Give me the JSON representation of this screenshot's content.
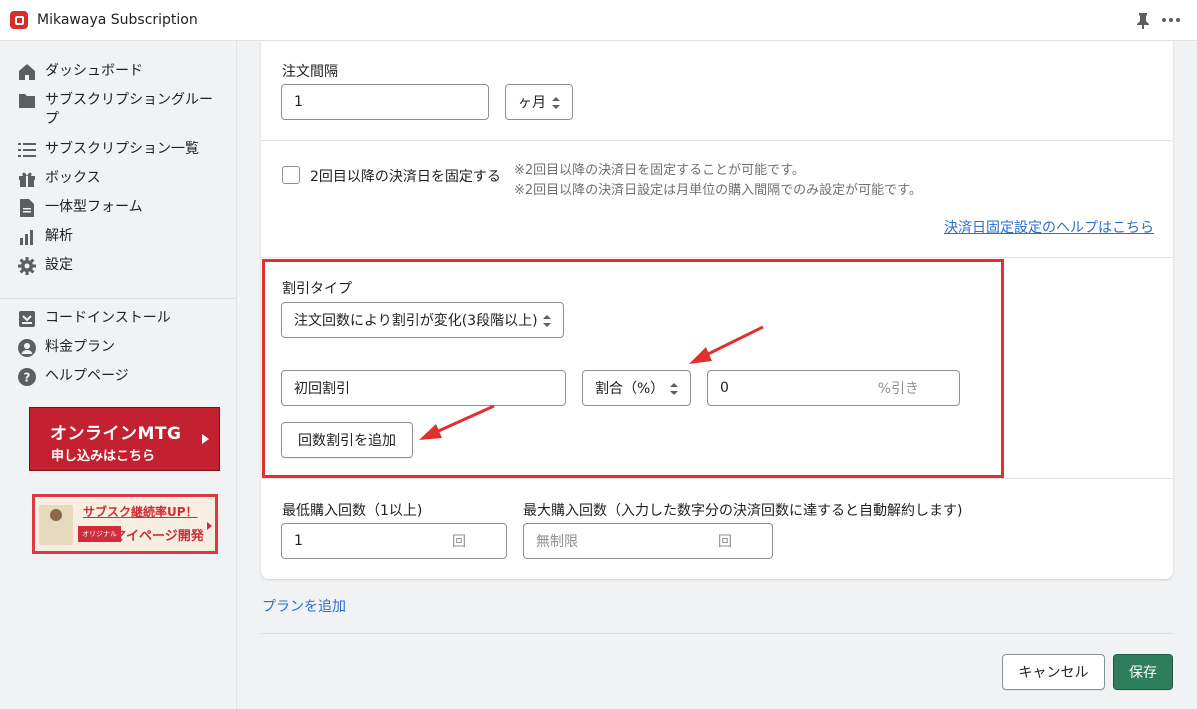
{
  "app": {
    "title": "Mikawaya Subscription",
    "icons": {
      "logo": "app-logo-icon",
      "pin": "pin-icon",
      "more": "more-icon"
    }
  },
  "sidebar": {
    "items": [
      {
        "label": "ダッシュボード",
        "icon": "home-icon"
      },
      {
        "label": "サブスクリプショングループ",
        "icon": "folder-icon"
      },
      {
        "label": "サブスクリプション一覧",
        "icon": "list-icon"
      },
      {
        "label": "ボックス",
        "icon": "gift-icon"
      },
      {
        "label": "一体型フォーム",
        "icon": "document-icon"
      },
      {
        "label": "解析",
        "icon": "chart-icon"
      },
      {
        "label": "設定",
        "icon": "gear-icon"
      }
    ],
    "items2": [
      {
        "label": "コードインストール",
        "icon": "install-icon"
      },
      {
        "label": "料金プラン",
        "icon": "user-icon"
      },
      {
        "label": "ヘルプページ",
        "icon": "question-icon"
      }
    ],
    "banner_mtg": {
      "line1": "オンラインMTG",
      "line2": "申し込みはこちら"
    },
    "banner_sub": {
      "line1": "サブスク継続率UP！",
      "tag": "オリジナル",
      "line2": "マイページ開発"
    }
  },
  "form": {
    "interval": {
      "label": "注文間隔",
      "value": "1",
      "unit": "ヶ月"
    },
    "fixed_date": {
      "label": "2回目以降の決済日を固定する",
      "note1": "※2回目以降の決済日を固定することが可能です。",
      "note2": "※2回目以降の決済日設定は月単位の購入間隔でのみ設定が可能です。",
      "help_link": "決済日固定設定のヘルプはこちら"
    },
    "discount": {
      "label": "割引タイプ",
      "type_value": "注文回数により割引が変化(3段階以上)",
      "first_name": "初回割引",
      "rate_type": "割合（%）",
      "rate_value": "0",
      "rate_suffix": "%引き",
      "add_button": "回数割引を追加"
    },
    "min_purchase": {
      "label": "最低購入回数（1以上)",
      "value": "1",
      "suffix": "回"
    },
    "max_purchase": {
      "label": "最大購入回数（入力した数字分の決済回数に達すると自動解約します)",
      "placeholder": "無制限",
      "suffix": "回"
    }
  },
  "footer": {
    "add_plan": "プランを追加",
    "cancel": "キャンセル",
    "save": "保存"
  },
  "colors": {
    "accent": "#2e7d5b",
    "link": "#2c6ecb",
    "highlight": "#e03131",
    "brand_red": "#c3212f"
  }
}
